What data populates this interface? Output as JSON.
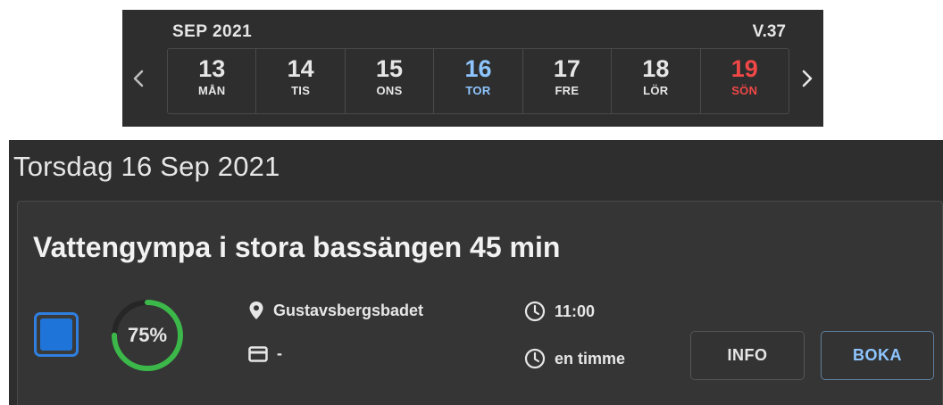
{
  "week": {
    "month": "SEP 2021",
    "week_number": "V.37",
    "days": [
      {
        "num": "13",
        "weekday": "MÅN"
      },
      {
        "num": "14",
        "weekday": "TIS"
      },
      {
        "num": "15",
        "weekday": "ONS"
      },
      {
        "num": "16",
        "weekday": "TOR"
      },
      {
        "num": "17",
        "weekday": "FRE"
      },
      {
        "num": "18",
        "weekday": "LÖR"
      },
      {
        "num": "19",
        "weekday": "SÖN"
      }
    ],
    "today_index": 3,
    "sunday_index": 6
  },
  "section": {
    "date_title": "Torsdag 16 Sep 2021"
  },
  "event": {
    "title": "Vattengympa i stora bassängen 45 min",
    "occupancy_label": "75%",
    "occupancy_fraction": 0.75,
    "location": "Gustavsbergsbadet",
    "payment": "-",
    "time": "11:00",
    "duration": "en timme",
    "info_label": "INFO",
    "book_label": "BOKA"
  },
  "colors": {
    "accent": "#1e74d8",
    "today": "#8ec5ff",
    "sunday": "#f04747",
    "gauge": "#3cb84a"
  },
  "icons": {
    "prev": "chevron-left-icon",
    "next": "chevron-right-icon",
    "location": "map-pin-icon",
    "payment": "credit-card-icon",
    "time": "clock-icon"
  }
}
